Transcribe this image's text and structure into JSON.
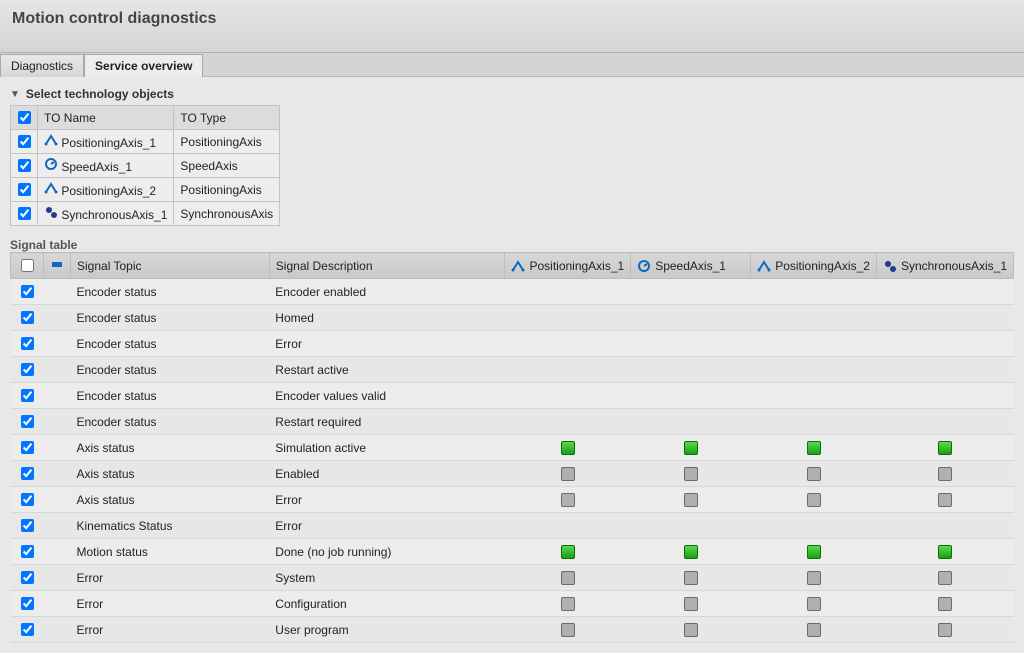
{
  "title": "Motion control diagnostics",
  "tabs": {
    "diagnostics": "Diagnostics",
    "service": "Service overview"
  },
  "section_select_label": "Select technology objects",
  "to_headers": {
    "name": "TO Name",
    "type": "TO Type"
  },
  "to_rows": [
    {
      "name": "PositioningAxis_1",
      "type": "PositioningAxis",
      "icon": "pos"
    },
    {
      "name": "SpeedAxis_1",
      "type": "SpeedAxis",
      "icon": "speed"
    },
    {
      "name": "PositioningAxis_2",
      "type": "PositioningAxis",
      "icon": "pos"
    },
    {
      "name": "SynchronousAxis_1",
      "type": "SynchronousAxis",
      "icon": "sync"
    }
  ],
  "signal_table_label": "Signal table",
  "sig_headers": {
    "topic": "Signal Topic",
    "desc": "Signal Description",
    "axes": [
      {
        "label": "PositioningAxis_1",
        "icon": "pos"
      },
      {
        "label": "SpeedAxis_1",
        "icon": "speed"
      },
      {
        "label": "PositioningAxis_2",
        "icon": "pos"
      },
      {
        "label": "SynchronousAxis_1",
        "icon": "sync"
      }
    ]
  },
  "sig_rows": [
    {
      "topic": "Encoder status",
      "desc": "Encoder enabled",
      "leds": [
        null,
        null,
        null,
        null
      ]
    },
    {
      "topic": "Encoder status",
      "desc": "Homed",
      "leds": [
        null,
        null,
        null,
        null
      ]
    },
    {
      "topic": "Encoder status",
      "desc": "Error",
      "leds": [
        null,
        null,
        null,
        null
      ]
    },
    {
      "topic": "Encoder status",
      "desc": "Restart active",
      "leds": [
        null,
        null,
        null,
        null
      ]
    },
    {
      "topic": "Encoder status",
      "desc": "Encoder values valid",
      "leds": [
        null,
        null,
        null,
        null
      ]
    },
    {
      "topic": "Encoder status",
      "desc": "Restart required",
      "leds": [
        null,
        null,
        null,
        null
      ]
    },
    {
      "topic": "Axis status",
      "desc": "Simulation active",
      "leds": [
        "green",
        "green",
        "green",
        "green"
      ]
    },
    {
      "topic": "Axis status",
      "desc": "Enabled",
      "leds": [
        "gray",
        "gray",
        "gray",
        "gray"
      ]
    },
    {
      "topic": "Axis status",
      "desc": "Error",
      "leds": [
        "gray",
        "gray",
        "gray",
        "gray"
      ]
    },
    {
      "topic": "Kinematics Status",
      "desc": "Error",
      "leds": [
        null,
        null,
        null,
        null
      ]
    },
    {
      "topic": "Motion status",
      "desc": "Done (no job running)",
      "leds": [
        "green",
        "green",
        "green",
        "green"
      ]
    },
    {
      "topic": "Error",
      "desc": "System",
      "leds": [
        "gray",
        "gray",
        "gray",
        "gray"
      ]
    },
    {
      "topic": "Error",
      "desc": "Configuration",
      "leds": [
        "gray",
        "gray",
        "gray",
        "gray"
      ]
    },
    {
      "topic": "Error",
      "desc": "User program",
      "leds": [
        "gray",
        "gray",
        "gray",
        "gray"
      ]
    }
  ]
}
